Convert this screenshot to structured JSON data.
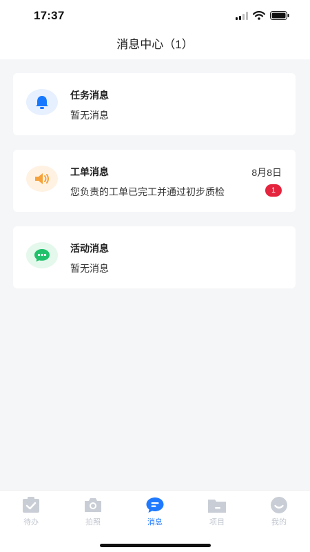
{
  "status_bar": {
    "time": "17:37"
  },
  "header": {
    "title": "消息中心（1）"
  },
  "messages": [
    {
      "title": "任务消息",
      "preview": "暂无消息",
      "date": "",
      "badge": ""
    },
    {
      "title": "工单消息",
      "preview": "您负责的工单已完工并通过初步质检",
      "date": "8月8日",
      "badge": "1"
    },
    {
      "title": "活动消息",
      "preview": "暂无消息",
      "date": "",
      "badge": ""
    }
  ],
  "tabs": [
    {
      "label": "待办",
      "active": false
    },
    {
      "label": "拍照",
      "active": false
    },
    {
      "label": "消息",
      "active": true
    },
    {
      "label": "项目",
      "active": false
    },
    {
      "label": "我的",
      "active": false
    }
  ],
  "colors": {
    "accent": "#1e79ff",
    "badge": "#e5243d",
    "bell": "#1677ff",
    "speaker": "#f5a23b",
    "chat": "#21c16b",
    "tab_inactive": "#c2c7d0"
  }
}
